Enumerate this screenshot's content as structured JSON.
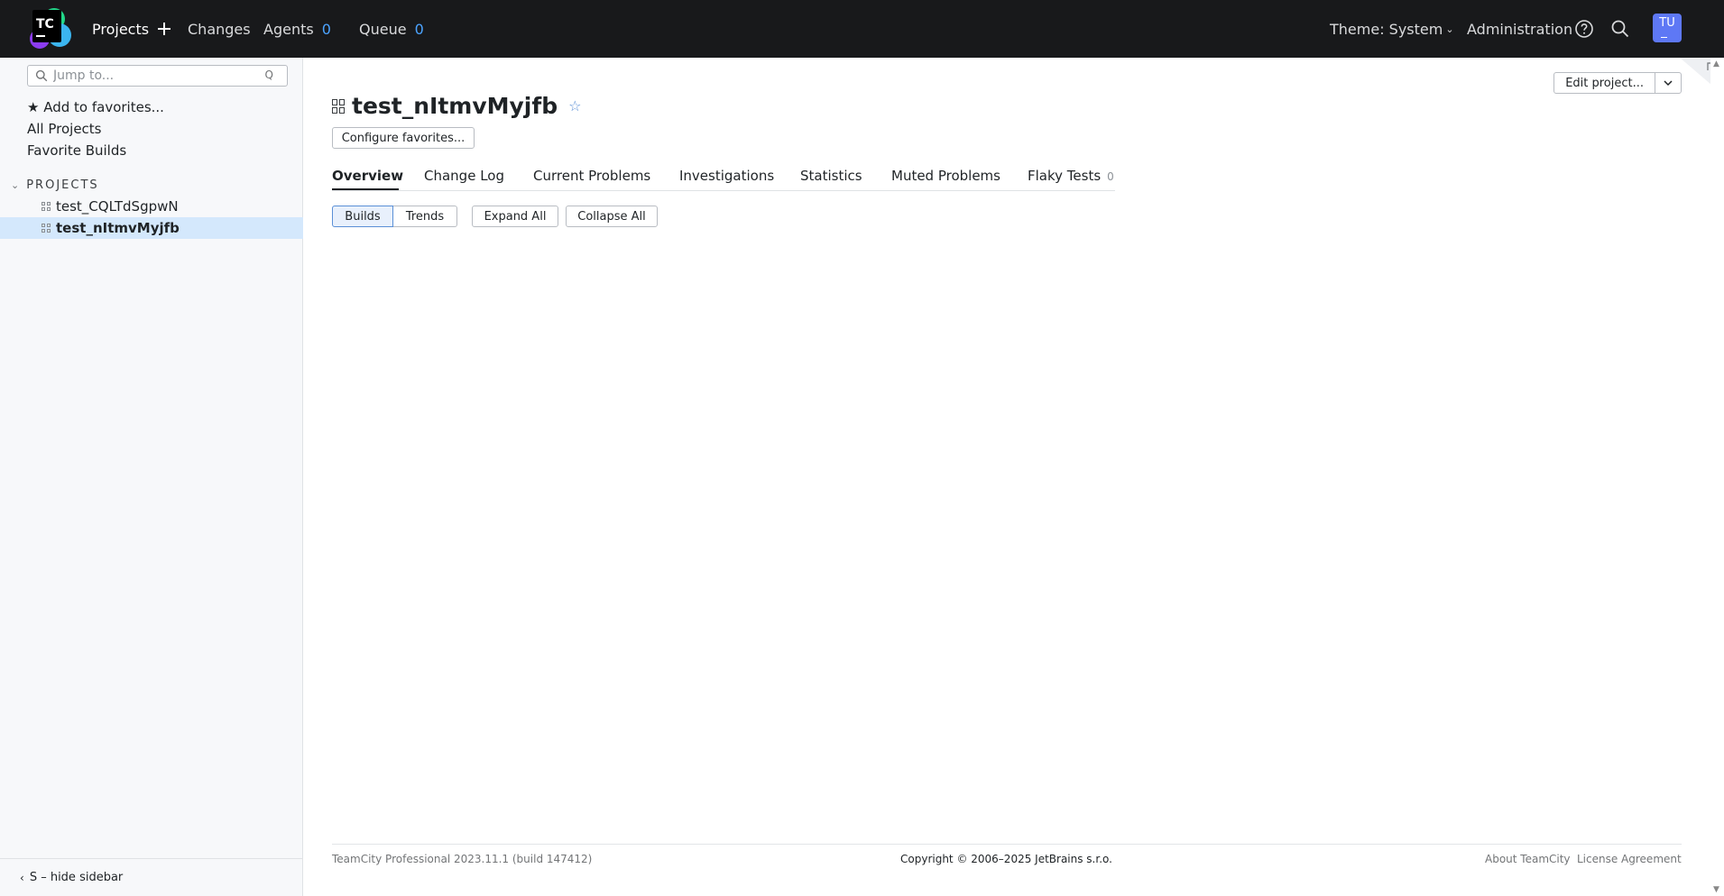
{
  "header": {
    "logo_text": "TC",
    "nav": {
      "projects": "Projects",
      "changes": "Changes",
      "agents": "Agents",
      "agents_count": "0",
      "queue": "Queue",
      "queue_count": "0"
    },
    "theme": "Theme: System",
    "administration": "Administration",
    "avatar_initials": "TU"
  },
  "sidebar": {
    "search_placeholder": "Jump to...",
    "search_shortcut": "Q",
    "add_favorites": "★ Add to favorites...",
    "all_projects": "All Projects",
    "favorite_builds": "Favorite Builds",
    "projects_header": "PROJECTS",
    "projects": [
      {
        "name": "test_CQLTdSgpwN",
        "active": false
      },
      {
        "name": "test_nItmvMyjfb",
        "active": true
      }
    ],
    "hide_sidebar": "S – hide sidebar"
  },
  "main": {
    "title": "test_nItmvMyjfb",
    "configure_favorites": "Configure favorites...",
    "edit_project": "Edit project...",
    "tabs": [
      {
        "label": "Overview",
        "active": true
      },
      {
        "label": "Change Log"
      },
      {
        "label": "Current Problems"
      },
      {
        "label": "Investigations"
      },
      {
        "label": "Statistics"
      },
      {
        "label": "Muted Problems"
      },
      {
        "label": "Flaky Tests",
        "count": "0"
      }
    ],
    "view_toggle": {
      "builds": "Builds",
      "trends": "Trends",
      "selected": "Builds"
    },
    "expand_all": "Expand All",
    "collapse_all": "Collapse All"
  },
  "footer": {
    "version": "TeamCity Professional 2023.11.1 (build 147412)",
    "copyright": "Copyright © 2006–2025 JetBrains s.r.o.",
    "about": "About TeamCity",
    "license": "License Agreement"
  },
  "colors": {
    "header_bg": "#18191b",
    "accent": "#4ba3ff",
    "avatar_bg": "#5e78f5",
    "active_project_bg": "#d4e8fc"
  }
}
